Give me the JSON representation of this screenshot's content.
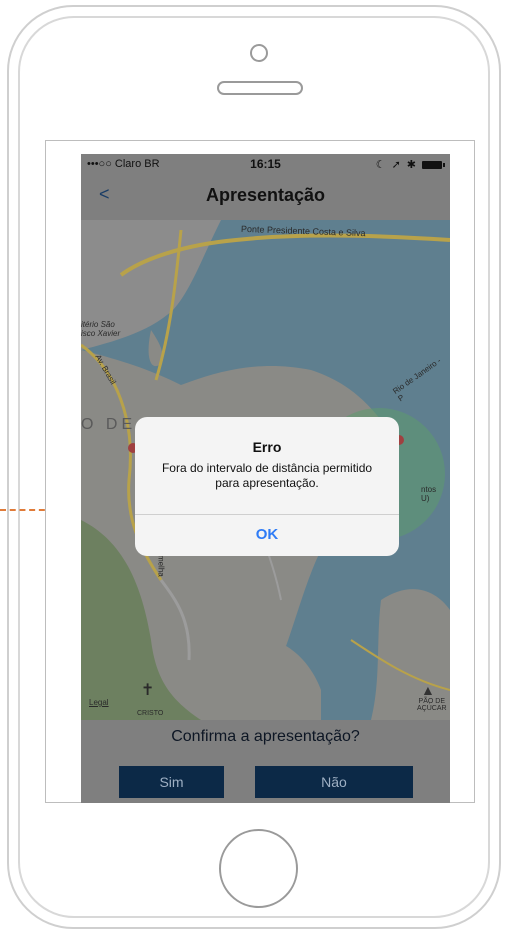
{
  "status_bar": {
    "carrier": "•••○○ Claro BR",
    "time": "16:15"
  },
  "nav": {
    "back_label": "<",
    "title": "Apresentação"
  },
  "map": {
    "labels": {
      "bridge": "Ponte Presidente Costa e Silva",
      "cemetery": "itério São\nisco Xavier",
      "av_brasil": "Av. Brasil",
      "district": "O DE",
      "road_right": "Rio de Janeiro - P",
      "airport": "ntos\nU)",
      "street": "rmelha",
      "legal": "Legal",
      "cristo": "CRISTO",
      "pao": "PÃO DE\nAÇÚCAR"
    }
  },
  "bottom": {
    "question": "Confirma a apresentação?",
    "yes_label": "Sim",
    "no_label": "Não"
  },
  "alert": {
    "title": "Erro",
    "message": "Fora do intervalo de distância permitido para apresentação.",
    "ok_label": "OK"
  },
  "colors": {
    "accent": "#2f7cf6",
    "button_bg": "#0c2947",
    "dashed_line": "#e07b39"
  }
}
